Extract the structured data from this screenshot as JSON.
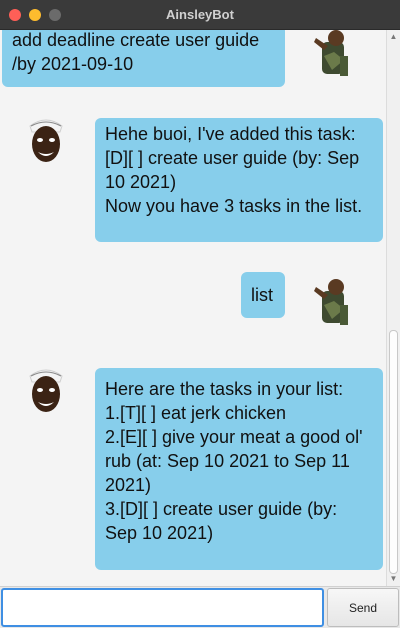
{
  "window": {
    "title": "AinsleyBot"
  },
  "messages": [
    {
      "sender": "user",
      "lines": [
        "add deadline create user guide",
        "/by 2021-09-10"
      ]
    },
    {
      "sender": "bot",
      "lines": [
        "Hehe buoi, I've added this task:",
        "[D][ ] create user guide (by: Sep",
        "10 2021)",
        "Now you have 3 tasks in the list."
      ]
    },
    {
      "sender": "user",
      "lines": [
        "list"
      ]
    },
    {
      "sender": "bot",
      "lines": [
        "Here are the tasks in your list:",
        "1.[T][ ] eat jerk chicken",
        "2.[E][ ] give your meat a good ol'",
        "rub (at: Sep 10 2021 to Sep 11",
        "2021)",
        "3.[D][ ] create user guide (by:",
        "Sep 10 2021)"
      ]
    }
  ],
  "input": {
    "value": "",
    "placeholder": ""
  },
  "send_button": {
    "label": "Send"
  },
  "colors": {
    "bubble": "#87ceeb",
    "titlebar": "#3a3a3a",
    "input_focus": "#3f8fe3"
  }
}
